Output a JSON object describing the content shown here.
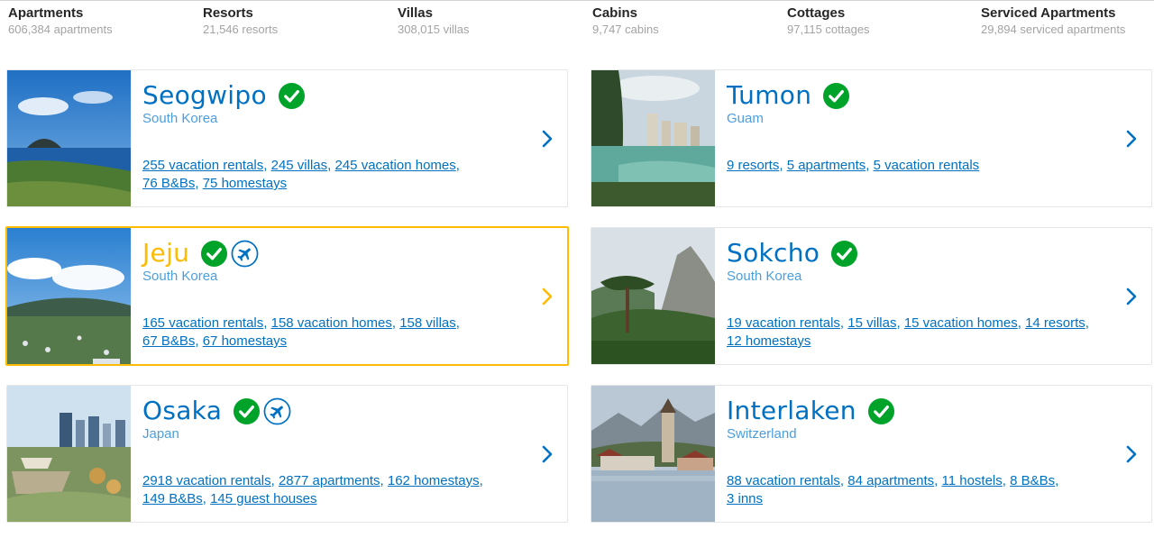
{
  "property_types": [
    {
      "name": "Apartments",
      "count": "606,384 apartments"
    },
    {
      "name": "Resorts",
      "count": "21,546 resorts"
    },
    {
      "name": "Villas",
      "count": "308,015 villas"
    },
    {
      "name": "Cabins",
      "count": "9,747 cabins"
    },
    {
      "name": "Cottages",
      "count": "97,115 cottages"
    },
    {
      "name": "Serviced Apartments",
      "count": "29,894 serviced apartments"
    }
  ],
  "colors": {
    "link_blue": "#0071c2",
    "country_blue": "#4c9ee0",
    "verified_green": "#00a32a",
    "active_border": "#febb02"
  },
  "destinations": [
    {
      "city": "Seogwipo",
      "country": "South Korea",
      "badges": [
        "check-icon"
      ],
      "links": [
        "255 vacation rentals",
        "245 villas",
        "245 vacation homes",
        "76 B&Bs",
        "75 homestays"
      ]
    },
    {
      "city": "Tumon",
      "country": "Guam",
      "badges": [
        "check-icon"
      ],
      "links": [
        "9 resorts",
        "5 apartments",
        "5 vacation rentals"
      ]
    },
    {
      "city": "Jeju",
      "country": "South Korea",
      "badges": [
        "check-icon",
        "airplane-icon"
      ],
      "active": true,
      "links": [
        "165 vacation rentals",
        "158 vacation homes",
        "158 villas",
        "67 B&Bs",
        "67 homestays"
      ]
    },
    {
      "city": "Sokcho",
      "country": "South Korea",
      "badges": [
        "check-icon"
      ],
      "links": [
        "19 vacation rentals",
        "15 villas",
        "15 vacation homes",
        "14 resorts",
        "12 homestays"
      ]
    },
    {
      "city": "Osaka",
      "country": "Japan",
      "badges": [
        "check-icon",
        "airplane-icon"
      ],
      "links": [
        "2918 vacation rentals",
        "2877 apartments",
        "162 homestays",
        "149 B&Bs",
        "145 guest houses"
      ]
    },
    {
      "city": "Interlaken",
      "country": "Switzerland",
      "badges": [
        "check-icon"
      ],
      "links": [
        "88 vacation rentals",
        "84 apartments",
        "11 hostels",
        "8 B&Bs",
        "3 inns"
      ]
    }
  ]
}
